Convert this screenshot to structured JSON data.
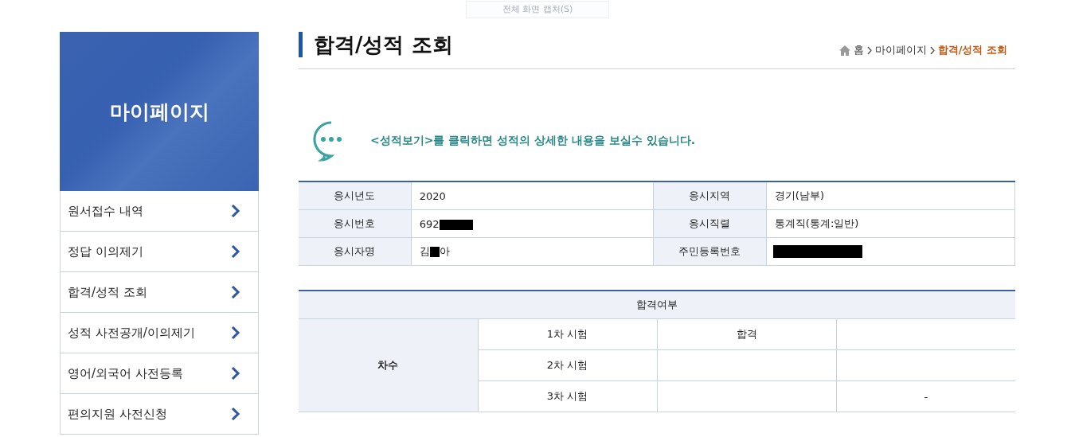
{
  "capture_hint": "전체 화면 캡처(S)",
  "sidebar": {
    "title": "마이페이지",
    "items": [
      {
        "label": "원서접수 내역",
        "selected": false
      },
      {
        "label": "정답 이의제기",
        "selected": false
      },
      {
        "label": "합격/성적 조회",
        "selected": false
      },
      {
        "label": "성적 사전공개/이의제기",
        "selected": false
      },
      {
        "label": "영어/외국어 사전등록",
        "selected": false
      },
      {
        "label": "편의지원 사전신청",
        "selected": false
      }
    ]
  },
  "page_title": "합격/성적 조회",
  "breadcrumb": [
    {
      "label": "홈",
      "current": false
    },
    {
      "label": "마이페이지",
      "current": false
    },
    {
      "label": "합격/성적 조회",
      "current": true
    }
  ],
  "notice": "<성적보기>를 클릭하면 성적의 상세한 내용을 보실수 있습니다.",
  "info_table": {
    "rows": [
      [
        {
          "label": "응시년도",
          "value": "2020",
          "redacted": false
        },
        {
          "label": "응시지역",
          "value": "경기(남부)",
          "redacted": false
        }
      ],
      [
        {
          "label": "응시번호",
          "value": "692",
          "redacted": true
        },
        {
          "label": "응시직렬",
          "value": "통계직(통계:일반)",
          "redacted": false
        }
      ],
      [
        {
          "label": "응시자명",
          "value": "김",
          "redacted": true,
          "value_after": "아"
        },
        {
          "label": "주민등록번호",
          "redacted": true
        }
      ]
    ]
  },
  "result_table": {
    "title": "합격여부",
    "row_header": "차수",
    "rows": [
      {
        "stage": "1차 시험",
        "column_2": "합격"
      },
      {
        "stage": "2차 시험"
      },
      {
        "stage": "3차 시험",
        "column_3": "-"
      }
    ]
  }
}
